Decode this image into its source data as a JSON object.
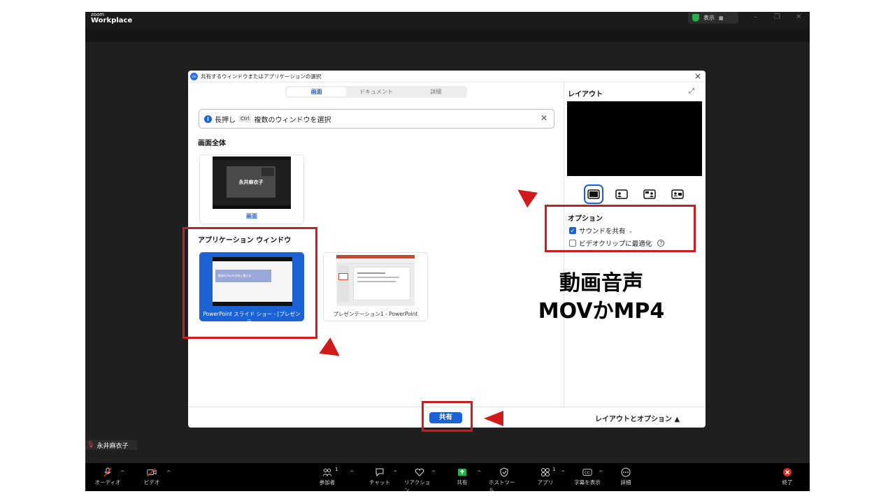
{
  "app": {
    "brand_small": "zoom",
    "brand_big": "Workplace",
    "view_label": "表示",
    "participant_name": "永井麻衣子"
  },
  "dialog": {
    "title": "共有するウィンドウまたはアプリケーションの選択",
    "tabs": [
      {
        "label": "画面",
        "active": true
      },
      {
        "label": "ドキュメント",
        "active": false
      },
      {
        "label": "詳細",
        "active": false
      }
    ],
    "info": {
      "prefix": "長押し",
      "key": "Ctrl",
      "suffix": "複数のウィンドウを選択"
    },
    "whole_screen": {
      "heading": "画面全体",
      "item_label": "画面",
      "thumb_text": "永井麻衣子"
    },
    "app_windows": {
      "heading": "アプリケーション ウィンドウ",
      "items": [
        {
          "label": "PowerPoint スライド ショー - [プレゼンテ...",
          "selected": true,
          "thumb_text": "動画をZoom共有に備える"
        },
        {
          "label": "プレゼンテーション1 - PowerPoint",
          "selected": false
        }
      ]
    },
    "right_panel": {
      "layout_title": "レイアウト",
      "layout_icons": [
        "layout-full-icon",
        "layout-side-person-icon",
        "layout-person-right-icon",
        "layout-two-person-icon"
      ],
      "options_title": "オプション",
      "options": [
        {
          "label": "サウンドを共有",
          "checked": true
        },
        {
          "label": "ビデオクリップに最適化",
          "checked": false
        }
      ]
    },
    "footer": {
      "share_button": "共有",
      "layout_options": "レイアウトとオプション ▲"
    }
  },
  "toolbar": [
    {
      "label": "オーディオ",
      "icon": "mic-muted-icon"
    },
    {
      "label": "ビデオ",
      "icon": "video-off-icon"
    },
    {
      "label": "参加者",
      "icon": "participants-icon",
      "count": "1"
    },
    {
      "label": "チャット",
      "icon": "chat-icon"
    },
    {
      "label": "リアクション",
      "icon": "heart-icon"
    },
    {
      "label": "共有",
      "icon": "share-icon"
    },
    {
      "label": "ホストツール",
      "icon": "host-shield-icon"
    },
    {
      "label": "アプリ",
      "icon": "apps-icon",
      "count": "1"
    },
    {
      "label": "字幕を表示",
      "icon": "cc-icon"
    },
    {
      "label": "詳細",
      "icon": "more-icon"
    },
    {
      "label": "終了",
      "icon": "end-icon"
    }
  ],
  "annotation": {
    "line1": "動画音声",
    "line2": "MOVかMP4",
    "color": "#d11a1a"
  }
}
